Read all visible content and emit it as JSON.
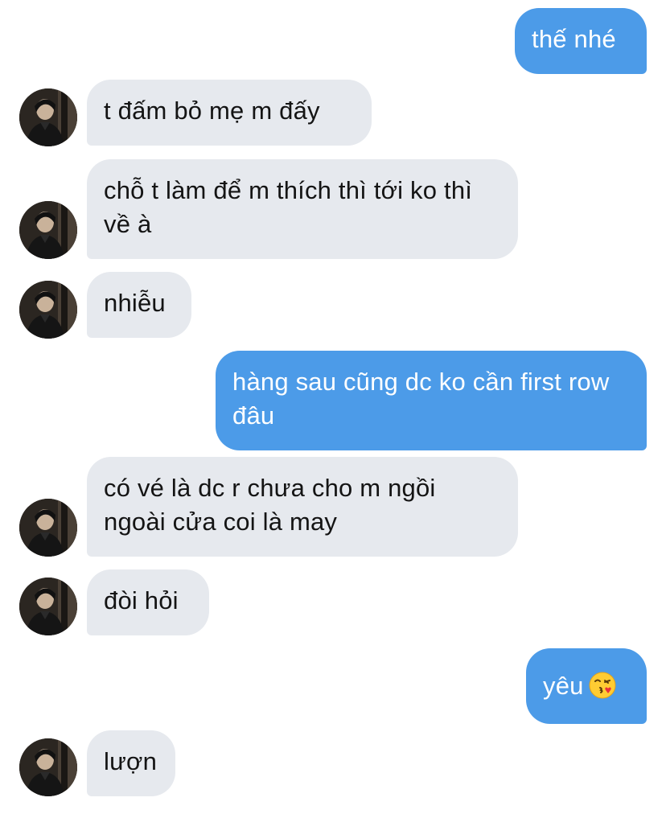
{
  "conversation": {
    "messages": [
      {
        "dir": "out",
        "text": "thế nhé"
      },
      {
        "dir": "in",
        "text": "t đấm bỏ mẹ m đấy"
      },
      {
        "dir": "in",
        "text": "chỗ t làm để m thích thì tới ko thì về à"
      },
      {
        "dir": "in",
        "text": "nhiễu"
      },
      {
        "dir": "out",
        "text": "hàng sau cũng dc ko cần first row đâu"
      },
      {
        "dir": "in",
        "text": "có vé là dc r chưa cho m ngồi ngoài cửa coi là may"
      },
      {
        "dir": "in",
        "text": "đòi hỏi"
      },
      {
        "dir": "out",
        "text": "yêu",
        "emoji": "face-blowing-kiss"
      },
      {
        "dir": "in",
        "text": "lượn"
      }
    ]
  },
  "colors": {
    "outgoing_bubble": "#4c9be8",
    "incoming_bubble": "#e6e9ee",
    "outgoing_text": "#ffffff",
    "incoming_text": "#141414"
  }
}
